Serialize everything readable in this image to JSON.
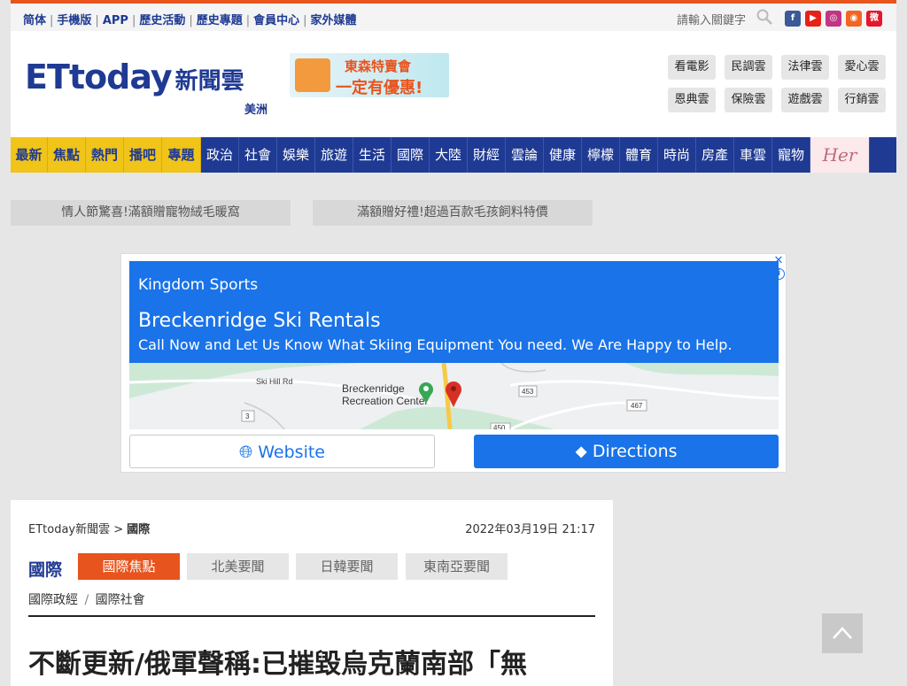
{
  "topbar": {
    "links": [
      "简体",
      "手機版",
      "APP",
      "歷史活動",
      "歷史專題",
      "會員中心",
      "家外媒體"
    ],
    "search_placeholder": "請輸入關鍵字",
    "social_icons": [
      "facebook-icon",
      "youtube-icon",
      "instagram-icon",
      "rss-icon",
      "weibo-icon"
    ]
  },
  "header": {
    "logo_text": "ETtoday",
    "logo_cn": "新聞雲",
    "region": "美洲",
    "banner_line1": "東森特賣會",
    "banner_line2": "一定有優惠!",
    "clouds": [
      "看電影",
      "民調雲",
      "法律雲",
      "愛心雲",
      "恩典雲",
      "保險雲",
      "遊戲雲",
      "行銷雲"
    ]
  },
  "nav": {
    "hot": [
      "最新",
      "焦點",
      "熱門",
      "播吧",
      "專題"
    ],
    "items": [
      "政治",
      "社會",
      "娛樂",
      "旅遊",
      "生活",
      "國際",
      "大陸",
      "財經",
      "雲論",
      "健康",
      "檸檬",
      "體育",
      "時尚",
      "房產",
      "車雲",
      "寵物"
    ],
    "her_label": "Her"
  },
  "promos": [
    "情人節驚喜!滿額贈寵物絨毛暖窩",
    "滿額贈好禮!超過百款毛孩飼料特價"
  ],
  "ad": {
    "sponsor": "Kingdom Sports",
    "title": "Breckenridge Ski Rentals",
    "description": "Call Now and Let Us Know What Skiing Equipment You need. We Are Happy to Help.",
    "map_labels": {
      "road": "Ski Hill Rd",
      "place1": "Breckenridge",
      "place2": "Recreation Center",
      "r453": "453",
      "r467": "467",
      "r3": "3",
      "r450": "450"
    },
    "website_label": "Website",
    "directions_label": "Directions",
    "colors": {
      "brand": "#1a73e8"
    }
  },
  "article": {
    "breadcrumb_home": "ETtoday新聞雲 >",
    "breadcrumb_section": "國際",
    "date": "2022年03月19日 21:17",
    "section_title": "國際",
    "tabs": [
      "國際焦點",
      "北美要聞",
      "日韓要聞",
      "東南亞要聞"
    ],
    "sub1": "國際政經",
    "sub_sep": "/",
    "sub2": "國際社會",
    "headline": "不斷更新/俄軍聲稱:已摧毀烏克蘭南部「無"
  },
  "colors": {
    "nav_blue": "#1f3a93",
    "accent_orange": "#e8541e",
    "hot_yellow": "#f0c419"
  }
}
